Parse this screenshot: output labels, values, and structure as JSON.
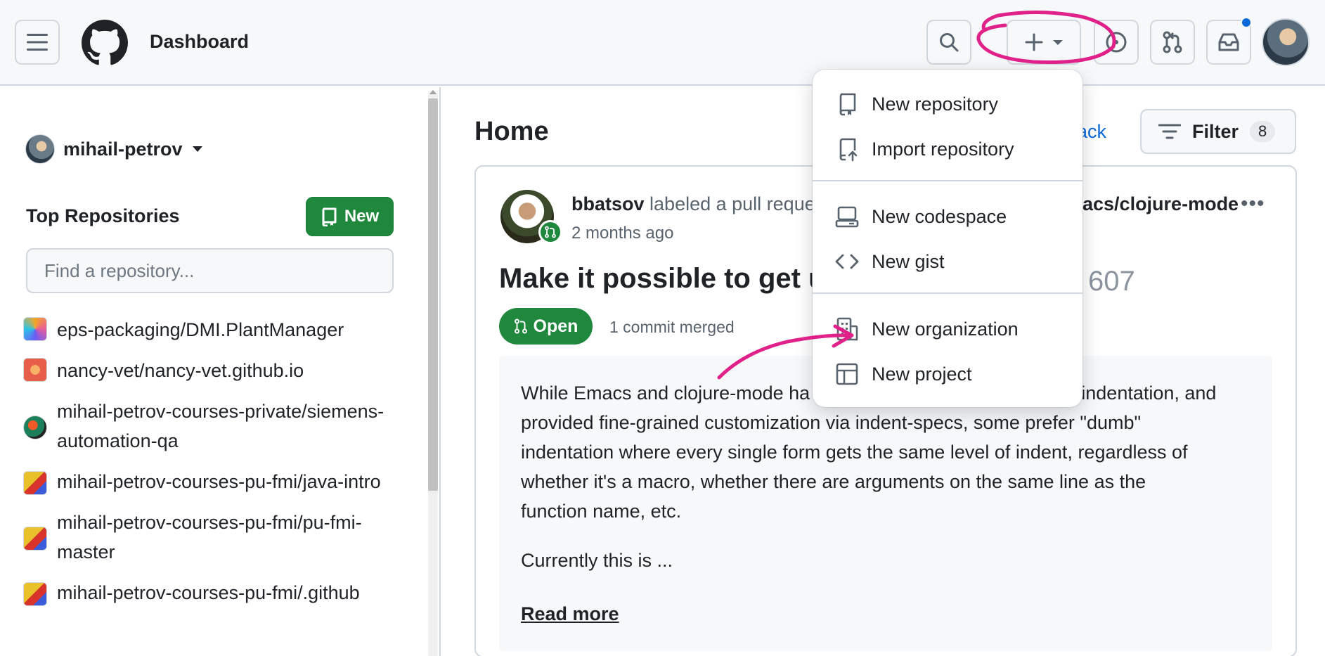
{
  "header": {
    "title": "Dashboard",
    "icons": [
      "menu-icon",
      "github-logo",
      "search-icon",
      "plus-icon",
      "issues-icon",
      "pull-requests-icon",
      "inbox-icon"
    ]
  },
  "sidebar": {
    "user": "mihail-petrov",
    "top_repositories_label": "Top Repositories",
    "new_button": "New",
    "search_placeholder": "Find a repository...",
    "repositories": [
      {
        "name": "eps-packaging/DMI.PlantManager",
        "avatar_color": "#f5a623"
      },
      {
        "name": "nancy-vet/nancy-vet.github.io",
        "avatar_color": "#e85d4a"
      },
      {
        "name": "mihail-petrov-courses-private/siemens-automation-qa",
        "avatar_color": "#1b7f5a"
      },
      {
        "name": "mihail-petrov-courses-pu-fmi/java-intro",
        "avatar_color": "#e9c12b"
      },
      {
        "name": "mihail-petrov-courses-pu-fmi/pu-fmi-master",
        "avatar_color": "#e9c12b"
      },
      {
        "name": "mihail-petrov-courses-pu-fmi/.github",
        "avatar_color": "#e9c12b"
      }
    ]
  },
  "main": {
    "title": "Home",
    "back_link": "ack",
    "filter": {
      "label": "Filter",
      "count": "8"
    },
    "feed": {
      "actor": "bbatsov",
      "action": "labeled a pull reque",
      "repo": "acs/clojure-mode",
      "time": "2 months ago",
      "pr_title": "Make it possible to get u",
      "pr_number": "607",
      "status": "Open",
      "commits": "1 commit merged",
      "body_lines": [
        "While Emacs and clojure-mode ha",
        "\" indentation, and",
        "provided fine-grained customization via indent-specs, some prefer \"dumb\"",
        "indentation where every single form gets the same level of indent, regardless of",
        "whether it's a macro, whether there are arguments on the same line as the",
        "function name, etc."
      ],
      "body_more": "Currently this is ...",
      "read_more": "Read more"
    }
  },
  "dropdown": {
    "items": [
      {
        "label": "New repository",
        "icon": "repo-icon"
      },
      {
        "label": "Import repository",
        "icon": "repo-push-icon"
      },
      {
        "label": "New codespace",
        "icon": "codespace-icon"
      },
      {
        "label": "New gist",
        "icon": "code-icon"
      },
      {
        "label": "New organization",
        "icon": "organization-icon"
      },
      {
        "label": "New project",
        "icon": "table-icon"
      }
    ]
  },
  "colors": {
    "accent_green": "#1f883d",
    "link_blue": "#0969da",
    "annotation_magenta": "#e0218a"
  }
}
